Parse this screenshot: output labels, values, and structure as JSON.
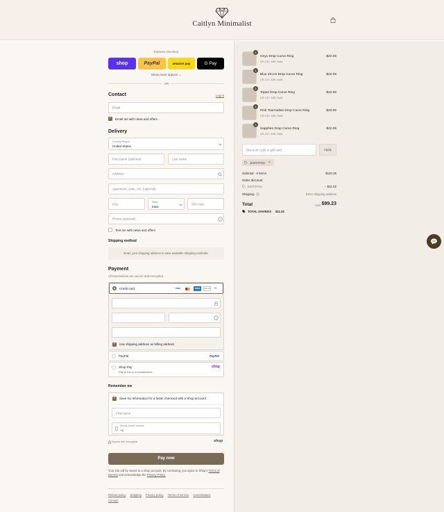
{
  "header": {
    "store_name": "Caitlyn Minimalist"
  },
  "express": {
    "title": "Express checkout",
    "shop_label": "shop",
    "paypal_label": "PayPal",
    "amazon_label": "amazon pay",
    "gpay_label": "G Pay",
    "more_options": "Show more options ⌄",
    "or": "OR"
  },
  "contact": {
    "heading": "Contact",
    "login": "Log in",
    "email_placeholder": "Email",
    "news_label": "Email me with news and offers"
  },
  "delivery": {
    "heading": "Delivery",
    "country_label": "Country/Region",
    "country_value": "United States",
    "first_name": "First name (optional)",
    "last_name": "Last name",
    "address": "Address",
    "apartment": "Apartment, suite, etc. (optional)",
    "city": "City",
    "state_label": "State",
    "state_value": "Iowa",
    "zip": "ZIP code",
    "phone": "Phone (optional)",
    "text_label": "Text me with news and offers"
  },
  "shipping_method": {
    "heading": "Shipping method",
    "message": "Enter your shipping address to view available shipping methods."
  },
  "payment": {
    "heading": "Payment",
    "subtitle": "All transactions are secure and encrypted.",
    "credit_card": "Credit card",
    "card_brands": [
      "VISA",
      "MC",
      "AMEX",
      "DISCOVER",
      "+5"
    ],
    "billing_label": "Use shipping address as billing address",
    "paypal": "PayPal",
    "paypal_logo": "PayPal",
    "shop_pay": "Shop Pay",
    "shop_pay_sub": "Pay in full or in installments",
    "shop_logo": "shop"
  },
  "remember": {
    "heading": "Remember me",
    "save_label": "Save my information for a faster checkout with a Shop account",
    "first_name": "First name",
    "mobile_label": "Mobile phone number",
    "mobile_value": "+1",
    "secure": "Secure and encrypted",
    "shop_logo": "shop"
  },
  "pay_button": "Pay now",
  "legal": {
    "text": "Your info will be saved to a Shop account. By continuing, you agree to Shop's",
    "tos": "Terms of Service",
    "and": "and acknowledge the",
    "privacy": "Privacy Policy."
  },
  "footer_links": [
    "Refund policy",
    "Shipping",
    "Privacy policy",
    "Terms of service",
    "Cancellations",
    "Contact"
  ],
  "cart": {
    "items": [
      {
        "qty": "1",
        "name": "Onyx Drop Curve Ring",
        "variant": "US 3.5 / 18K Gold",
        "price": "$22.05"
      },
      {
        "qty": "1",
        "name": "Blue Zircon Drop Curve Ring",
        "variant": "US 3.5 / 18K Gold",
        "price": "$22.05"
      },
      {
        "qty": "1",
        "name": "Topaz Drop Curve Ring",
        "variant": "US 3.5 / 18K Gold",
        "price": "$22.05"
      },
      {
        "qty": "1",
        "name": "Pink Tourmaline Drop Curve Ring",
        "variant": "US 3.5 / 18K Gold",
        "price": "$22.05"
      },
      {
        "qty": "1",
        "name": "Sapphire Drop Curve Ring",
        "variant": "US 3.5 / 18K Gold",
        "price": "$22.05"
      }
    ],
    "discount_placeholder": "Discount code or gift card",
    "apply": "Apply",
    "applied_code": "JUST4YOU",
    "subtotal_label": "Subtotal · 5 items",
    "subtotal_value": "$110.25",
    "order_discount_label": "Order discount",
    "discount_code": "JUST4YOU",
    "discount_value": "− $11.02",
    "shipping_label": "Shipping",
    "shipping_value": "Enter shipping address",
    "total_label": "Total",
    "currency": "USD",
    "total_value": "$99.23",
    "savings_label": "TOTAL SAVINGS",
    "savings_value": "$11.02"
  },
  "colors": {
    "accent": "#7a6a58",
    "shop_purple": "#5a31f4",
    "paypal_yellow": "#ffc439",
    "header_bg": "#f7f0ea"
  }
}
